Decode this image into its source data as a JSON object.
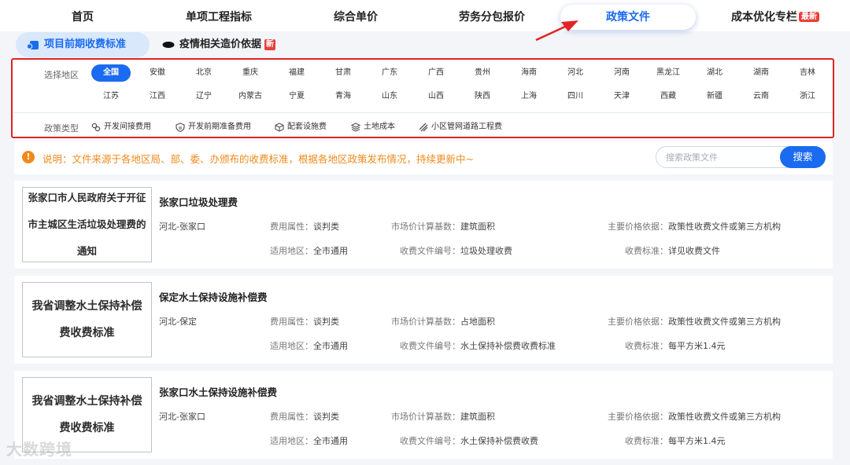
{
  "nav": {
    "tabs": [
      {
        "label": "首页"
      },
      {
        "label": "单项工程指标"
      },
      {
        "label": "综合单价"
      },
      {
        "label": "劳务分包报价"
      },
      {
        "label": "政策文件"
      },
      {
        "label": "成本优化专栏",
        "badge": "最新"
      }
    ],
    "active_index": 4
  },
  "subtabs": [
    {
      "label": "项目前期收费标准"
    },
    {
      "label": "疫情相关造价依据",
      "badge": "新"
    }
  ],
  "filter": {
    "region_label": "选择地区",
    "regions_row1": [
      "全国",
      "安徽",
      "北京",
      "重庆",
      "福建",
      "甘肃",
      "广东",
      "广西",
      "贵州",
      "海南",
      "河北",
      "河南",
      "黑龙江",
      "湖北",
      "湖南",
      "吉林"
    ],
    "regions_row2": [
      "江苏",
      "江西",
      "辽宁",
      "内蒙古",
      "宁夏",
      "青海",
      "山东",
      "山西",
      "陕西",
      "上海",
      "四川",
      "天津",
      "西藏",
      "新疆",
      "云南",
      "浙江"
    ],
    "selected_region": "全国",
    "type_label": "政策类型",
    "types": [
      {
        "label": "开发间接费用",
        "icon": "gears-icon"
      },
      {
        "label": "开发前期准备费用",
        "icon": "shield-icon"
      },
      {
        "label": "配套设施费",
        "icon": "cube-icon"
      },
      {
        "label": "土地成本",
        "icon": "layers-icon"
      },
      {
        "label": "小区管网道路工程费",
        "icon": "pipes-icon"
      }
    ]
  },
  "notice": {
    "text": "说明：文件来源于各地区局、部、委、办颁布的收费标准，根据各地区政策发布情况，持续更新中~"
  },
  "search": {
    "placeholder": "搜索政策文件",
    "button": "搜索"
  },
  "labels": {
    "fee_attr": "费用属性：",
    "calc_base": "市场价计算基数：",
    "price_basis": "主要价格依据：",
    "scope": "适用地区：",
    "doc_no": "收费文件编号：",
    "standard": "收费标准："
  },
  "cards": [
    {
      "thumb": "张家口市人民政府关于开征市主城区生活垃圾处理费的通知",
      "title": "张家口垃圾处理费",
      "region": "河北-张家口",
      "fee_attr": "谈判类",
      "calc_base": "建筑面积",
      "price_basis": "政策性收费文件或第三方机构",
      "scope": "全市通用",
      "doc_no": "垃圾处理收费",
      "standard": "详见收费文件"
    },
    {
      "thumb": "我省调整水土保持补偿费收费标准",
      "title": "保定水土保持设施补偿费",
      "region": "河北-保定",
      "fee_attr": "谈判类",
      "calc_base": "占地面积",
      "price_basis": "政策性收费文件或第三方机构",
      "scope": "全市通用",
      "doc_no": "水土保持补偿费收费标准",
      "standard": "每平方米1.4元"
    },
    {
      "thumb": "我省调整水土保持补偿费收费标准",
      "title": "张家口水土保持设施补偿费",
      "region": "河北-张家口",
      "fee_attr": "谈判类",
      "calc_base": "建筑面积",
      "price_basis": "政策性收费文件或第三方机构",
      "scope": "全市通用",
      "doc_no": "水土保持补偿费收费",
      "standard": "每平方米1.4元"
    }
  ],
  "watermark": "大数跨境",
  "colors": {
    "accent": "#1a6bf0",
    "highlight_border": "#e02424",
    "notice": "#f08a1c",
    "badge": "#e8403a"
  }
}
